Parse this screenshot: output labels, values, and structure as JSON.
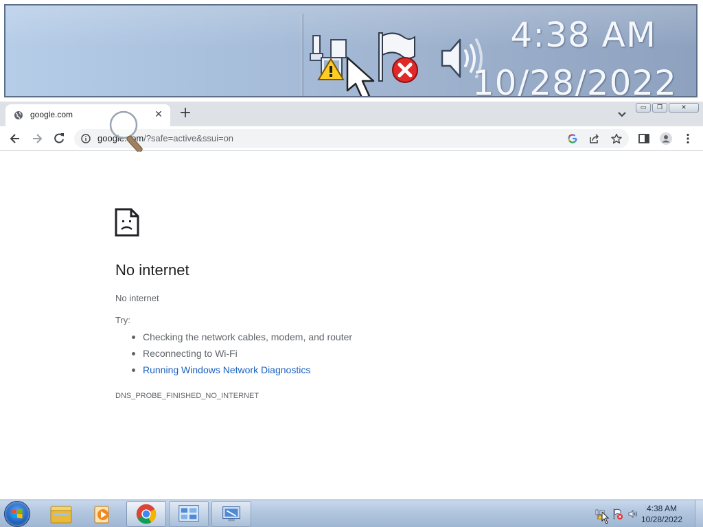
{
  "zoomed_tray": {
    "time": "4:38 AM",
    "date": "10/28/2022",
    "icons": [
      "network-warning-icon",
      "action-center-error-icon",
      "speaker-icon"
    ]
  },
  "browser": {
    "tab": {
      "title": "google.com",
      "close_glyph": "✕",
      "icon": "globe-icon"
    },
    "new_tab_glyph": "+",
    "window_buttons": {
      "minimize": "▭",
      "maximize": "❐",
      "close": "✕"
    },
    "toolbar": {
      "url_host": "google.com",
      "url_rest": "/?safe=active&ssui=on",
      "icons": [
        "back-icon",
        "forward-icon",
        "reload-icon",
        "info-icon",
        "google-lens-icon",
        "share-icon",
        "star-icon",
        "side-panel-icon",
        "profile-icon",
        "menu-icon"
      ]
    }
  },
  "error_page": {
    "title": "No internet",
    "subtitle": "No internet",
    "try_label": "Try:",
    "suggestions": [
      {
        "text": "Checking the network cables, modem, and router",
        "link": false
      },
      {
        "text": "Reconnecting to Wi-Fi",
        "link": false
      },
      {
        "text": "Running Windows Network Diagnostics",
        "link": true
      }
    ],
    "error_code": "DNS_PROBE_FINISHED_NO_INTERNET",
    "link_color": "#1a5fbf"
  },
  "taskbar": {
    "items": [
      "start-button",
      "explorer-icon",
      "media-player-icon",
      "chrome-icon",
      "control-panel-icon",
      "remote-desktop-icon"
    ],
    "time": "4:38 AM",
    "date": "10/28/2022"
  }
}
